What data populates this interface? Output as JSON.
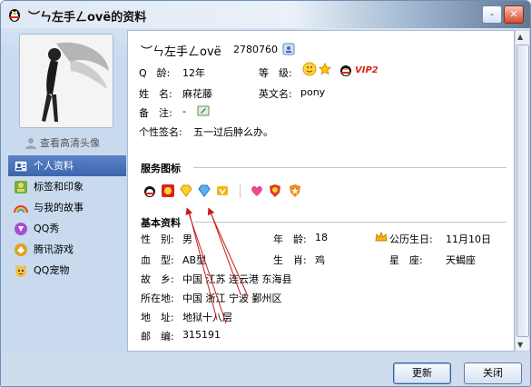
{
  "window": {
    "title": "︶ㄣ左手ㄥovё的资料",
    "minimize": "-",
    "close": "✕"
  },
  "sidebar": {
    "hd_avatar_link": "查看高清头像",
    "items": [
      {
        "label": "个人资料",
        "icon": "user-card-icon",
        "selected": true
      },
      {
        "label": "标签和印象",
        "icon": "tag-icon",
        "selected": false
      },
      {
        "label": "与我的故事",
        "icon": "rainbow-icon",
        "selected": false
      },
      {
        "label": "QQ秀",
        "icon": "qqshow-icon",
        "selected": false
      },
      {
        "label": "腾讯游戏",
        "icon": "game-icon",
        "selected": false
      },
      {
        "label": "QQ宠物",
        "icon": "pet-icon",
        "selected": false
      }
    ]
  },
  "profile": {
    "nickname": "︶ㄣ左手ㄥovё",
    "qq_number": "2780760",
    "q_age_label": "Q　龄:",
    "q_age": "12年",
    "level_label": "等　级:",
    "vip": "VIP2",
    "name_label": "姓　名:",
    "name": "麻花藤",
    "english_name_label": "英文名:",
    "english_name": "pony",
    "remark_label": "备　注:",
    "remark": "-",
    "signature_label": "个性签名:",
    "signature": "五一过后肿么办。"
  },
  "services": {
    "title": "服务图标"
  },
  "basic_info": {
    "title": "基本资料",
    "gender_label": "性　别:",
    "gender": "男",
    "age_label": "年　龄:",
    "age": "18",
    "birthday_label": "公历生日:",
    "birthday": "11月10日",
    "blood_label": "血　型:",
    "blood": "AB型",
    "zodiac_label": "生　肖:",
    "zodiac": "鸡",
    "constellation_label": "星　座:",
    "constellation": "天蝎座",
    "hometown_label": "故　乡:",
    "hometown": "中国 江苏 连云港 东海县",
    "location_label": "所在地:",
    "location": "中国 浙江 宁波 鄞州区",
    "address_label": "地　址:",
    "address": "地狱十八层",
    "postcode_label": "邮　编:",
    "postcode": "315191"
  },
  "buttons": {
    "refresh": "更新",
    "close": "关闭"
  },
  "colors": {
    "accent": "#4a72b8",
    "annotation_arrow": "#c81e1e"
  }
}
